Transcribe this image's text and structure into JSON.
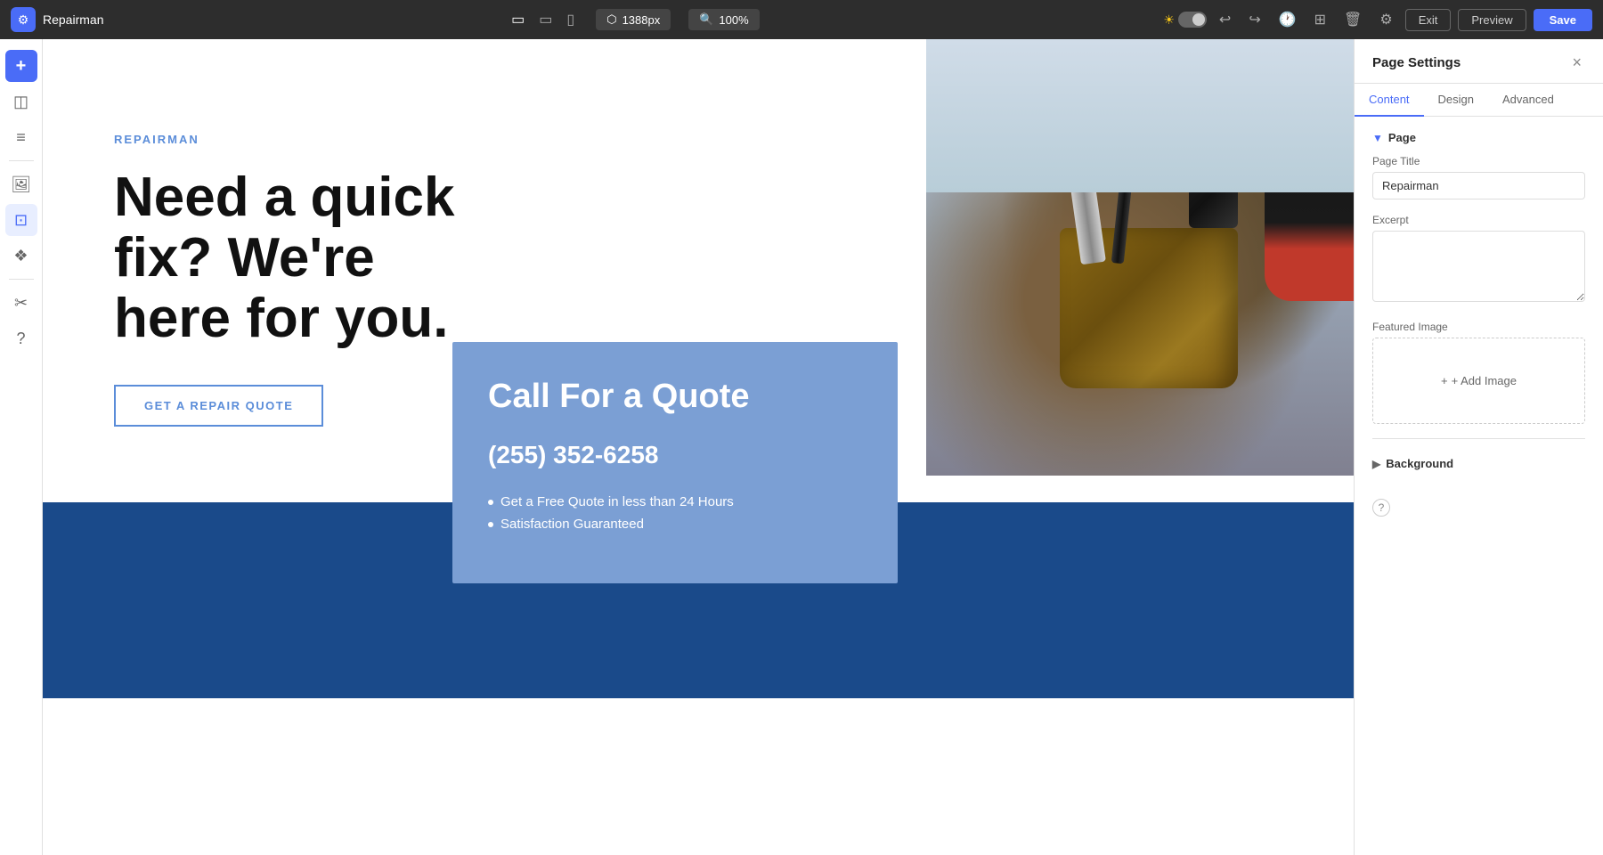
{
  "topbar": {
    "logo_icon": "⚙",
    "app_name": "Repairman",
    "device_desktop": "▭",
    "device_tablet": "▭",
    "device_mobile": "▯",
    "width_label": "⬡ 1388px",
    "zoom_label": "🔍 100%",
    "icon_undo": "↩",
    "icon_redo": "↪",
    "icon_history": "🕐",
    "icon_columns": "⊞",
    "icon_delete": "🗑",
    "icon_settings": "⚙",
    "exit_label": "Exit",
    "preview_label": "Preview",
    "save_label": "Save"
  },
  "sidebar": {
    "icons": [
      {
        "name": "add",
        "symbol": "+",
        "active": false
      },
      {
        "name": "layers",
        "symbol": "◫",
        "active": false
      },
      {
        "name": "content",
        "symbol": "≡",
        "active": false
      },
      {
        "name": "media",
        "symbol": "🖼",
        "active": true
      },
      {
        "name": "templates",
        "symbol": "⊡",
        "active": false
      },
      {
        "name": "widgets",
        "symbol": "❖",
        "active": false
      },
      {
        "name": "customize",
        "symbol": "✂",
        "active": false
      },
      {
        "name": "help",
        "symbol": "?",
        "active": false
      }
    ]
  },
  "hero": {
    "brand": "REPAIRMAN",
    "title": "Need a quick fix? We're here for you.",
    "cta_label": "GET A REPAIR QUOTE"
  },
  "call_card": {
    "title": "Call For a Quote",
    "phone": "(255) 352-6258",
    "bullets": [
      "Get a Free Quote in less than 24 Hours",
      "Satisfaction Guaranteed"
    ]
  },
  "add_block": "+",
  "right_panel": {
    "title": "Page Settings",
    "close": "×",
    "tabs": [
      {
        "label": "Content",
        "active": true
      },
      {
        "label": "Design",
        "active": false
      },
      {
        "label": "Advanced",
        "active": false
      }
    ],
    "page_section": {
      "label": "Page",
      "fields": {
        "page_title_label": "Page Title",
        "page_title_value": "Repairman",
        "excerpt_label": "Excerpt",
        "excerpt_placeholder": "",
        "featured_image_label": "Featured Image",
        "add_image_label": "+ Add Image"
      }
    },
    "background_section": {
      "label": "Background"
    },
    "help_label": "?"
  }
}
